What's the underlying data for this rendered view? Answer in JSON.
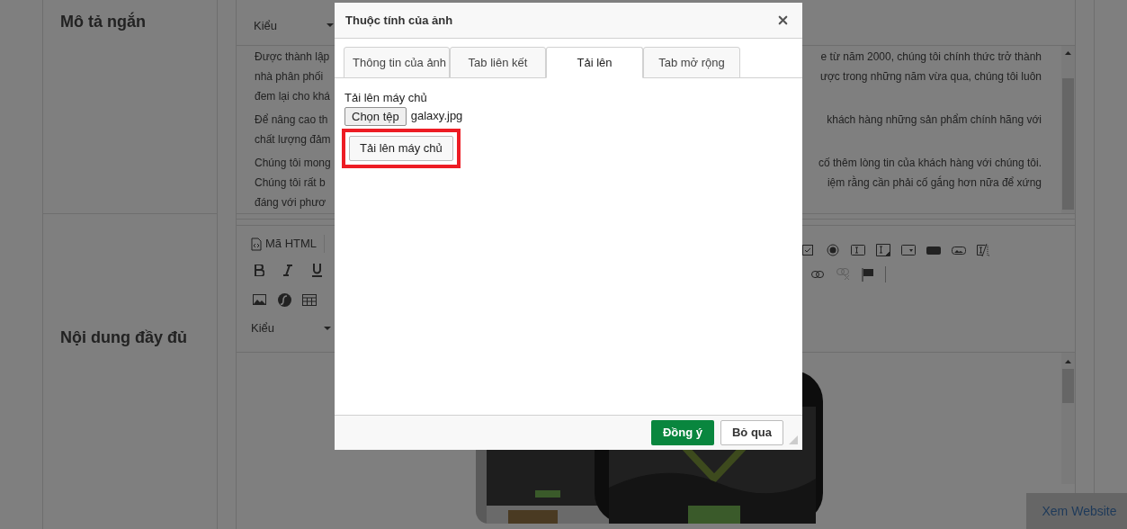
{
  "short_description": {
    "label": "Mô tả ngắn",
    "style_dropdown": "Kiểu",
    "paragraphs": [
      {
        "lines": [
          {
            "left": "Được thành lập",
            "right": "e từ năm 2000, chúng tôi chính thức trở thành"
          },
          {
            "left": "nhà phân phối",
            "right": "ược trong những năm vừa qua, chúng tôi luôn"
          },
          {
            "left": "đem lại cho khá"
          }
        ]
      },
      {
        "lines": [
          {
            "left": "Để nâng cao th",
            "right": "khách hàng những sản phẩm chính hãng với"
          },
          {
            "left": "chất lượng đảm"
          }
        ]
      },
      {
        "lines": [
          {
            "left": "Chúng tôi mong",
            "right": "cố thêm lòng tin của khách hàng với chúng tôi."
          },
          {
            "left": "Chúng tôi rất b",
            "right": "iệm rằng cần phải cố gắng hơn nữa để xứng"
          },
          {
            "left": "đáng với phươ"
          }
        ]
      }
    ]
  },
  "full_content": {
    "label": "Nội dung đầy đủ",
    "source_button": "Mã HTML",
    "style_dropdown": "Kiểu"
  },
  "dialog": {
    "title": "Thuộc tính của ảnh",
    "tabs": [
      {
        "label": "Thông tin của ảnh",
        "selected": false
      },
      {
        "label": "Tab liên kết",
        "selected": false
      },
      {
        "label": "Tải lên",
        "selected": true
      },
      {
        "label": "Tab mở rộng",
        "selected": false
      }
    ],
    "upload_label": "Tải lên máy chủ",
    "file_button": "Chọn tệp",
    "file_name": "galaxy.jpg",
    "upload_button": {
      "label": "Tải lên máy chủ",
      "highlighted": true
    },
    "ok_button": "Đồng ý",
    "cancel_button": "Bỏ qua"
  },
  "view_website": "Xem Website"
}
